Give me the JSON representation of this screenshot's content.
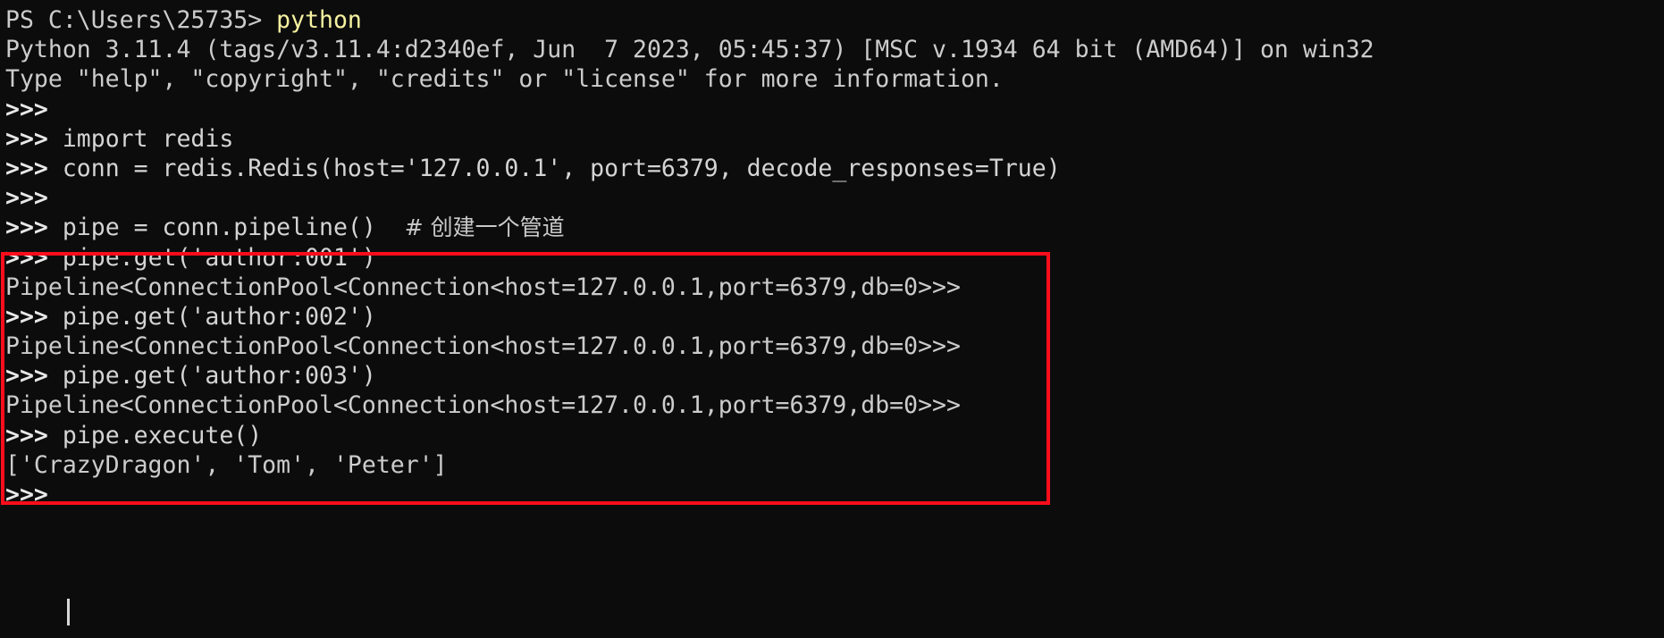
{
  "terminal": {
    "window_kind": "windows-powershell-python-repl",
    "background_color": "#0c0c0c",
    "foreground_color": "#cccccc",
    "accent_highlight_color": "#fb0d1b",
    "prompt_command_color": "#f6f2a0",
    "shell_prompt": "PS C:\\Users\\25735>",
    "shell_command": "python",
    "python_prompt": ">>>",
    "cursor_visible": true,
    "lines": [
      {
        "id": "line-1-shell-prompt",
        "type": "shell-command",
        "prompt": "PS C:\\Users\\25735>",
        "command": "python"
      },
      {
        "id": "line-2-python-banner",
        "type": "output",
        "text": "Python 3.11.4 (tags/v3.11.4:d2340ef, Jun  7 2023, 05:45:37) [MSC v.1934 64 bit (AMD64)] on win32"
      },
      {
        "id": "line-3-python-help-hint",
        "type": "output",
        "text": "Type \"help\", \"copyright\", \"credits\" or \"license\" for more information."
      },
      {
        "id": "line-4-empty-prompt",
        "type": "repl-command",
        "prompt": ">>>",
        "command": ""
      },
      {
        "id": "line-5-import-redis",
        "type": "repl-command",
        "prompt": ">>>",
        "command": "import redis"
      },
      {
        "id": "line-6-create-conn",
        "type": "repl-command",
        "prompt": ">>>",
        "command": "conn = redis.Redis(host='127.0.0.1', port=6379, decode_responses=True)"
      },
      {
        "id": "line-7-empty-prompt",
        "type": "repl-command",
        "prompt": ">>>",
        "command": ""
      },
      {
        "id": "line-8-create-pipeline",
        "type": "repl-command",
        "prompt": ">>>",
        "command": "pipe = conn.pipeline()",
        "comment": "# 创建一个管道",
        "highlighted": true
      },
      {
        "id": "line-9-pipe-get-001",
        "type": "repl-command",
        "prompt": ">>>",
        "command": "pipe.get('author:001')",
        "highlighted": true
      },
      {
        "id": "line-10-pipeline-repr-1",
        "type": "output",
        "text": "Pipeline<ConnectionPool<Connection<host=127.0.0.1,port=6379,db=0>>>",
        "highlighted": true
      },
      {
        "id": "line-11-pipe-get-002",
        "type": "repl-command",
        "prompt": ">>>",
        "command": "pipe.get('author:002')",
        "highlighted": true
      },
      {
        "id": "line-12-pipeline-repr-2",
        "type": "output",
        "text": "Pipeline<ConnectionPool<Connection<host=127.0.0.1,port=6379,db=0>>>",
        "highlighted": true
      },
      {
        "id": "line-13-pipe-get-003",
        "type": "repl-command",
        "prompt": ">>>",
        "command": "pipe.get('author:003')",
        "highlighted": true
      },
      {
        "id": "line-14-pipeline-repr-3",
        "type": "output",
        "text": "Pipeline<ConnectionPool<Connection<host=127.0.0.1,port=6379,db=0>>>",
        "highlighted": true
      },
      {
        "id": "line-15-pipe-execute",
        "type": "repl-command",
        "prompt": ">>>",
        "command": "pipe.execute()",
        "highlighted": true
      },
      {
        "id": "line-16-execute-result",
        "type": "output",
        "text": "['CrazyDragon', 'Tom', 'Peter']"
      },
      {
        "id": "line-17-final-prompt",
        "type": "repl-command",
        "prompt": ">>>",
        "command": ""
      }
    ]
  }
}
